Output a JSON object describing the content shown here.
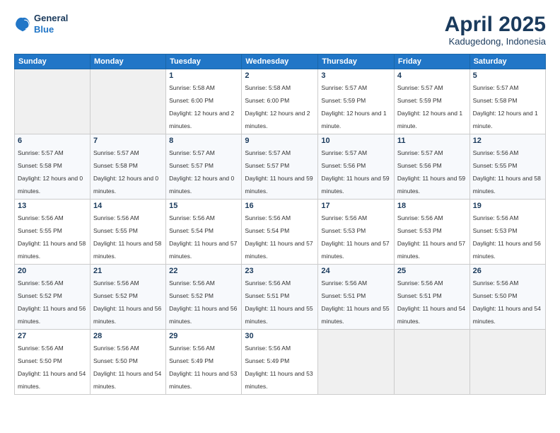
{
  "header": {
    "logo": {
      "general": "General",
      "blue": "Blue"
    },
    "title": "April 2025",
    "location": "Kadugedong, Indonesia"
  },
  "weekdays": [
    "Sunday",
    "Monday",
    "Tuesday",
    "Wednesday",
    "Thursday",
    "Friday",
    "Saturday"
  ],
  "weeks": [
    [
      {
        "day": "",
        "sunrise": "",
        "sunset": "",
        "daylight": ""
      },
      {
        "day": "",
        "sunrise": "",
        "sunset": "",
        "daylight": ""
      },
      {
        "day": "1",
        "sunrise": "Sunrise: 5:58 AM",
        "sunset": "Sunset: 6:00 PM",
        "daylight": "Daylight: 12 hours and 2 minutes."
      },
      {
        "day": "2",
        "sunrise": "Sunrise: 5:58 AM",
        "sunset": "Sunset: 6:00 PM",
        "daylight": "Daylight: 12 hours and 2 minutes."
      },
      {
        "day": "3",
        "sunrise": "Sunrise: 5:57 AM",
        "sunset": "Sunset: 5:59 PM",
        "daylight": "Daylight: 12 hours and 1 minute."
      },
      {
        "day": "4",
        "sunrise": "Sunrise: 5:57 AM",
        "sunset": "Sunset: 5:59 PM",
        "daylight": "Daylight: 12 hours and 1 minute."
      },
      {
        "day": "5",
        "sunrise": "Sunrise: 5:57 AM",
        "sunset": "Sunset: 5:58 PM",
        "daylight": "Daylight: 12 hours and 1 minute."
      }
    ],
    [
      {
        "day": "6",
        "sunrise": "Sunrise: 5:57 AM",
        "sunset": "Sunset: 5:58 PM",
        "daylight": "Daylight: 12 hours and 0 minutes."
      },
      {
        "day": "7",
        "sunrise": "Sunrise: 5:57 AM",
        "sunset": "Sunset: 5:58 PM",
        "daylight": "Daylight: 12 hours and 0 minutes."
      },
      {
        "day": "8",
        "sunrise": "Sunrise: 5:57 AM",
        "sunset": "Sunset: 5:57 PM",
        "daylight": "Daylight: 12 hours and 0 minutes."
      },
      {
        "day": "9",
        "sunrise": "Sunrise: 5:57 AM",
        "sunset": "Sunset: 5:57 PM",
        "daylight": "Daylight: 11 hours and 59 minutes."
      },
      {
        "day": "10",
        "sunrise": "Sunrise: 5:57 AM",
        "sunset": "Sunset: 5:56 PM",
        "daylight": "Daylight: 11 hours and 59 minutes."
      },
      {
        "day": "11",
        "sunrise": "Sunrise: 5:57 AM",
        "sunset": "Sunset: 5:56 PM",
        "daylight": "Daylight: 11 hours and 59 minutes."
      },
      {
        "day": "12",
        "sunrise": "Sunrise: 5:56 AM",
        "sunset": "Sunset: 5:55 PM",
        "daylight": "Daylight: 11 hours and 58 minutes."
      }
    ],
    [
      {
        "day": "13",
        "sunrise": "Sunrise: 5:56 AM",
        "sunset": "Sunset: 5:55 PM",
        "daylight": "Daylight: 11 hours and 58 minutes."
      },
      {
        "day": "14",
        "sunrise": "Sunrise: 5:56 AM",
        "sunset": "Sunset: 5:55 PM",
        "daylight": "Daylight: 11 hours and 58 minutes."
      },
      {
        "day": "15",
        "sunrise": "Sunrise: 5:56 AM",
        "sunset": "Sunset: 5:54 PM",
        "daylight": "Daylight: 11 hours and 57 minutes."
      },
      {
        "day": "16",
        "sunrise": "Sunrise: 5:56 AM",
        "sunset": "Sunset: 5:54 PM",
        "daylight": "Daylight: 11 hours and 57 minutes."
      },
      {
        "day": "17",
        "sunrise": "Sunrise: 5:56 AM",
        "sunset": "Sunset: 5:53 PM",
        "daylight": "Daylight: 11 hours and 57 minutes."
      },
      {
        "day": "18",
        "sunrise": "Sunrise: 5:56 AM",
        "sunset": "Sunset: 5:53 PM",
        "daylight": "Daylight: 11 hours and 57 minutes."
      },
      {
        "day": "19",
        "sunrise": "Sunrise: 5:56 AM",
        "sunset": "Sunset: 5:53 PM",
        "daylight": "Daylight: 11 hours and 56 minutes."
      }
    ],
    [
      {
        "day": "20",
        "sunrise": "Sunrise: 5:56 AM",
        "sunset": "Sunset: 5:52 PM",
        "daylight": "Daylight: 11 hours and 56 minutes."
      },
      {
        "day": "21",
        "sunrise": "Sunrise: 5:56 AM",
        "sunset": "Sunset: 5:52 PM",
        "daylight": "Daylight: 11 hours and 56 minutes."
      },
      {
        "day": "22",
        "sunrise": "Sunrise: 5:56 AM",
        "sunset": "Sunset: 5:52 PM",
        "daylight": "Daylight: 11 hours and 56 minutes."
      },
      {
        "day": "23",
        "sunrise": "Sunrise: 5:56 AM",
        "sunset": "Sunset: 5:51 PM",
        "daylight": "Daylight: 11 hours and 55 minutes."
      },
      {
        "day": "24",
        "sunrise": "Sunrise: 5:56 AM",
        "sunset": "Sunset: 5:51 PM",
        "daylight": "Daylight: 11 hours and 55 minutes."
      },
      {
        "day": "25",
        "sunrise": "Sunrise: 5:56 AM",
        "sunset": "Sunset: 5:51 PM",
        "daylight": "Daylight: 11 hours and 54 minutes."
      },
      {
        "day": "26",
        "sunrise": "Sunrise: 5:56 AM",
        "sunset": "Sunset: 5:50 PM",
        "daylight": "Daylight: 11 hours and 54 minutes."
      }
    ],
    [
      {
        "day": "27",
        "sunrise": "Sunrise: 5:56 AM",
        "sunset": "Sunset: 5:50 PM",
        "daylight": "Daylight: 11 hours and 54 minutes."
      },
      {
        "day": "28",
        "sunrise": "Sunrise: 5:56 AM",
        "sunset": "Sunset: 5:50 PM",
        "daylight": "Daylight: 11 hours and 54 minutes."
      },
      {
        "day": "29",
        "sunrise": "Sunrise: 5:56 AM",
        "sunset": "Sunset: 5:49 PM",
        "daylight": "Daylight: 11 hours and 53 minutes."
      },
      {
        "day": "30",
        "sunrise": "Sunrise: 5:56 AM",
        "sunset": "Sunset: 5:49 PM",
        "daylight": "Daylight: 11 hours and 53 minutes."
      },
      {
        "day": "",
        "sunrise": "",
        "sunset": "",
        "daylight": ""
      },
      {
        "day": "",
        "sunrise": "",
        "sunset": "",
        "daylight": ""
      },
      {
        "day": "",
        "sunrise": "",
        "sunset": "",
        "daylight": ""
      }
    ]
  ]
}
